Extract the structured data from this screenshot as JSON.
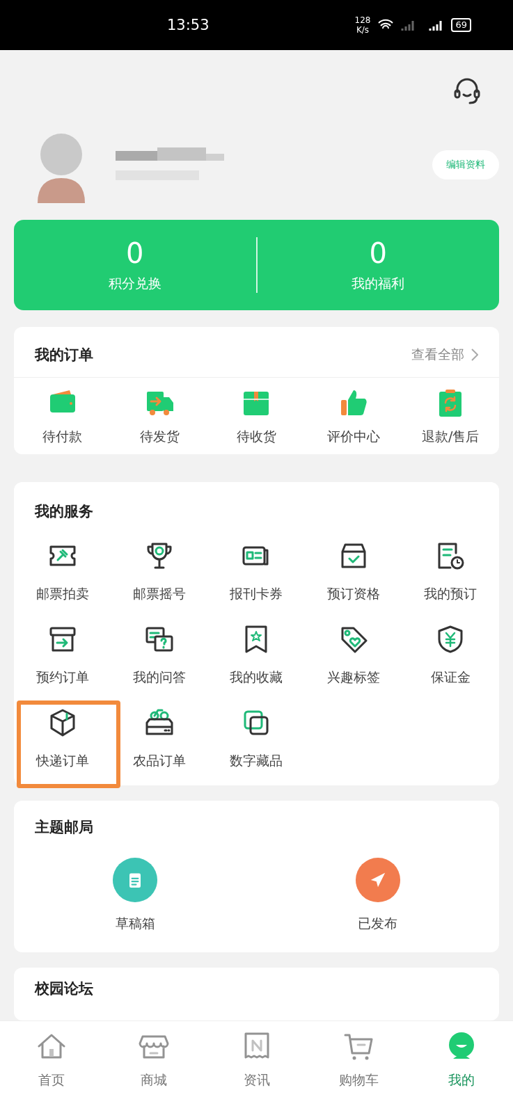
{
  "status_bar": {
    "time": "13:53",
    "net_speed": [
      "128",
      "K/s"
    ],
    "battery": "69"
  },
  "profile": {
    "edit_button": "编辑资料"
  },
  "stats": [
    {
      "value": "0",
      "label": "积分兑换"
    },
    {
      "value": "0",
      "label": "我的福利"
    }
  ],
  "orders": {
    "title": "我的订单",
    "view_all": "查看全部",
    "items": [
      "待付款",
      "待发货",
      "待收货",
      "评价中心",
      "退款/售后"
    ]
  },
  "services": {
    "title": "我的服务",
    "items": [
      {
        "label": "邮票拍卖",
        "highlighted": false
      },
      {
        "label": "邮票摇号",
        "highlighted": false
      },
      {
        "label": "报刊卡券",
        "highlighted": false
      },
      {
        "label": "预订资格",
        "highlighted": false
      },
      {
        "label": "我的预订",
        "highlighted": false
      },
      {
        "label": "预约订单",
        "highlighted": false
      },
      {
        "label": "我的问答",
        "highlighted": false
      },
      {
        "label": "我的收藏",
        "highlighted": false
      },
      {
        "label": "兴趣标签",
        "highlighted": false
      },
      {
        "label": "保证金",
        "highlighted": false
      },
      {
        "label": "快递订单",
        "highlighted": true
      },
      {
        "label": "农品订单",
        "highlighted": false
      },
      {
        "label": "数字藏品",
        "highlighted": false
      }
    ]
  },
  "theme_post": {
    "title": "主题邮局",
    "items": [
      {
        "label": "草稿箱",
        "color": "#3cc4b4"
      },
      {
        "label": "已发布",
        "color": "#f27c4e"
      }
    ]
  },
  "forum": {
    "title": "校园论坛"
  },
  "nav": [
    {
      "label": "首页",
      "selected": false
    },
    {
      "label": "商城",
      "selected": false
    },
    {
      "label": "资讯",
      "selected": false
    },
    {
      "label": "购物车",
      "selected": false
    },
    {
      "label": "我的",
      "selected": true
    }
  ]
}
